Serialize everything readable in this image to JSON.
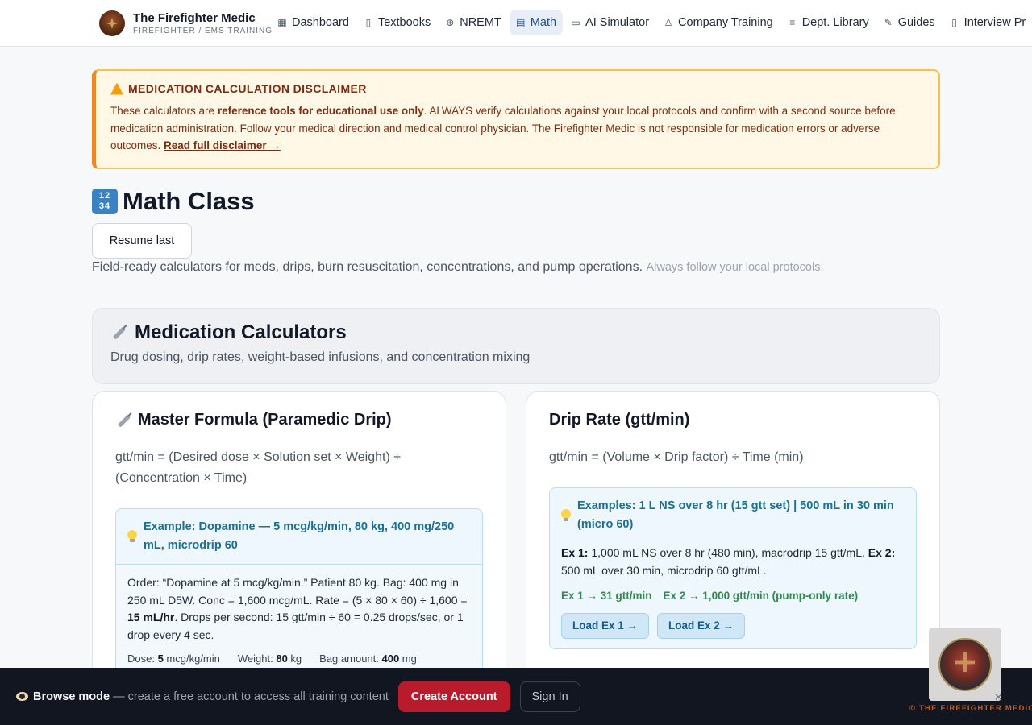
{
  "brand": {
    "title": "The Firefighter Medic",
    "subtitle": "FIREFIGHTER / EMS TRAINING"
  },
  "nav": {
    "items": [
      {
        "label": "Dashboard",
        "icon": "grid-icon",
        "glyph": "▦"
      },
      {
        "label": "Textbooks",
        "icon": "book-icon",
        "glyph": "▯"
      },
      {
        "label": "NREMT",
        "icon": "globe-icon",
        "glyph": "⊕"
      },
      {
        "label": "Math",
        "icon": "calculator-icon",
        "glyph": "▤",
        "active": true
      },
      {
        "label": "AI Simulator",
        "icon": "video-icon",
        "glyph": "▭"
      },
      {
        "label": "Company Training",
        "icon": "user-icon",
        "glyph": "♙"
      },
      {
        "label": "Dept. Library",
        "icon": "list-icon",
        "glyph": "≡"
      },
      {
        "label": "Guides",
        "icon": "pen-icon",
        "glyph": "✎"
      },
      {
        "label": "Interview Pr",
        "icon": "clipboard-icon",
        "glyph": "▯"
      }
    ]
  },
  "disclaimer": {
    "title": "MEDICATION CALCULATION DISCLAIMER",
    "text_1": "These calculators are ",
    "text_bold": "reference tools for educational use only",
    "text_2": ". ALWAYS verify calculations against your local protocols and confirm with a second source before medication administration. Follow your medical direction and medical control physician. The Firefighter Medic is not responsible for medication errors or adverse outcomes. ",
    "link": "Read full disclaimer →"
  },
  "page": {
    "icon_digits": [
      "12",
      "34"
    ],
    "title": "Math Class",
    "resume_label": "Resume last",
    "lead": "Field-ready calculators for meds, drips, burn resuscitation, concentrations, and pump operations.",
    "lead_muted": "Always follow your local protocols."
  },
  "section": {
    "title": "Medication Calculators",
    "subtitle": "Drug dosing, drip rates, weight-based infusions, and concentration mixing"
  },
  "cards": [
    {
      "title": "Master Formula (Paramedic Drip)",
      "formula": "gtt/min = (Desired dose × Solution set × Weight) ÷ (Concentration × Time)",
      "example_title": "Example: Dopamine — 5 mcg/kg/min, 80 kg, 400 mg/250 mL, microdrip 60",
      "example_body_1": "Order: “Dopamine at 5 mcg/kg/min.” Patient 80 kg. Bag: 400 mg in 250 mL D5W. Conc = 1,600 mcg/mL. Rate = (5 × 80 × 60) ÷ 1,600 = ",
      "example_body_bold": "15 mL/hr",
      "example_body_2": ". Drops per second: 15 gtt/min ÷ 60 = 0.25 drops/sec, or 1 drop every 4 sec.",
      "fields": [
        {
          "label": "Dose: ",
          "value": "5",
          "unit": " mcg/kg/min"
        },
        {
          "label": "Weight: ",
          "value": "80",
          "unit": " kg"
        },
        {
          "label": "Bag amount: ",
          "value": "400",
          "unit": " mg"
        }
      ]
    },
    {
      "title": "Drip Rate (gtt/min)",
      "formula": "gtt/min = (Volume × Drip factor) ÷ Time (min)",
      "example_title": "Examples: 1 L NS over 8 hr (15 gtt set) | 500 mL in 30 min (micro 60)",
      "ex1_label": "Ex 1:",
      "ex1_text": " 1,000 mL NS over 8 hr (480 min), macrodrip 15 gtt/mL.  ",
      "ex2_label": "Ex 2:",
      "ex2_text": " 500 mL over 30 min, microdrip 60 gtt/mL.",
      "result_1": "Ex 1 → 31 gtt/min",
      "result_2": "Ex 2 → 1,000 gtt/min (pump-only rate)",
      "load_1": "Load Ex 1 →",
      "load_2": "Load Ex 2 →"
    }
  ],
  "bottombar": {
    "browse_bold": "Browse mode",
    "browse_text": " — create a free account to access all training content",
    "create_label": "Create Account",
    "signin_label": "Sign In"
  },
  "badge": {
    "close": "✕",
    "caption": "© THE FIREFIGHTER MEDIC"
  },
  "colors": {
    "accent_red": "#b81c2c",
    "nav_active": "#1d4e89",
    "warning_border": "#f5c24d",
    "result_green": "#2f8a4e"
  }
}
